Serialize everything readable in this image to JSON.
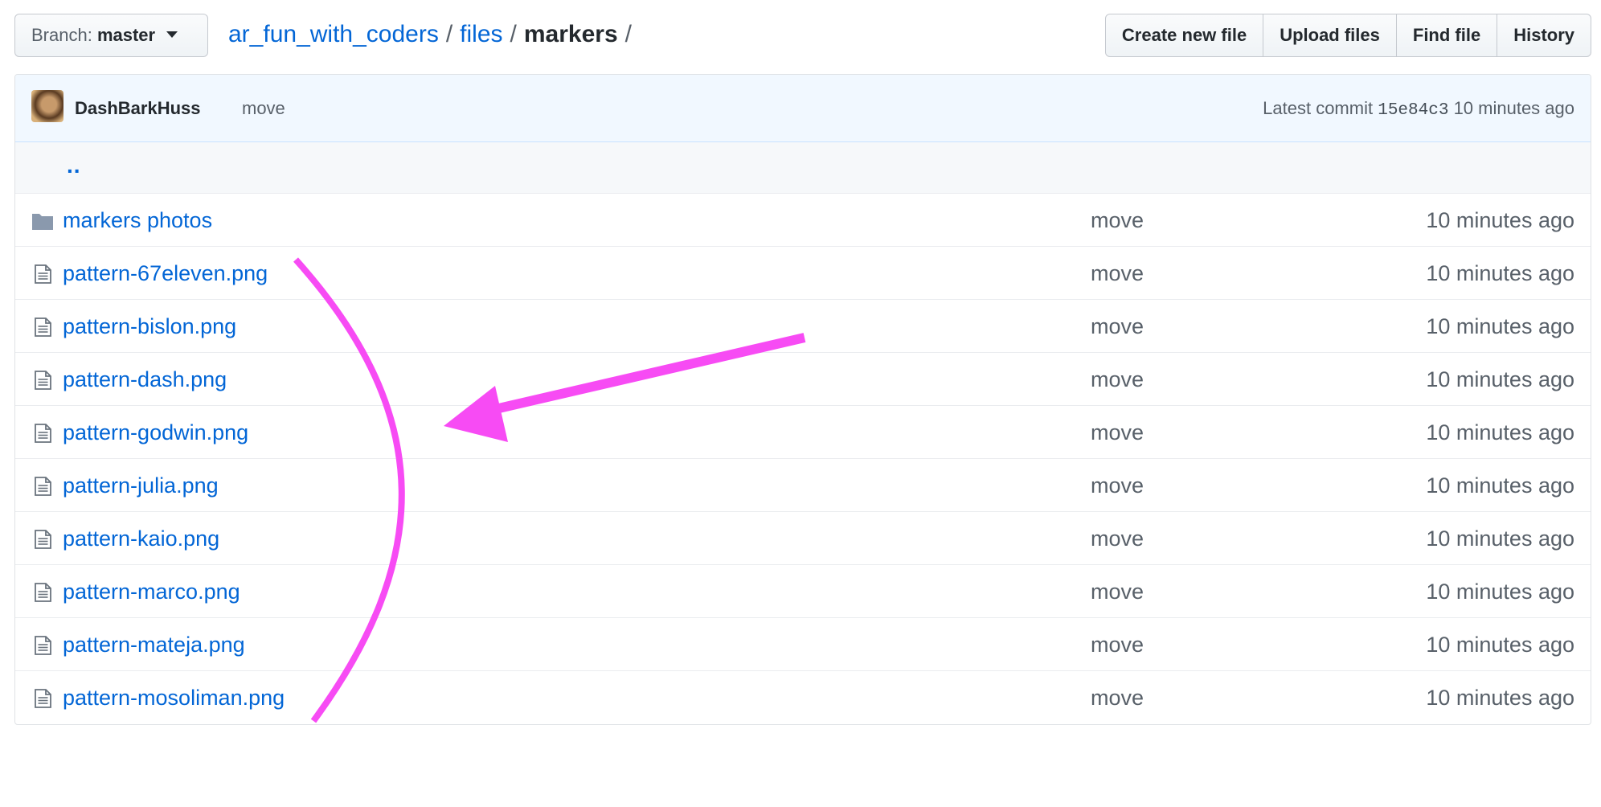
{
  "branch": {
    "label": "Branch:",
    "value": "master"
  },
  "breadcrumb": {
    "repo": "ar_fun_with_coders",
    "sep": "/",
    "folder": "files",
    "current": "markers"
  },
  "actions": [
    "Create new file",
    "Upload files",
    "Find file",
    "History"
  ],
  "commit": {
    "author": "DashBarkHuss",
    "message": "move",
    "latest_label": "Latest commit",
    "sha": "15e84c3",
    "age": "10 minutes ago"
  },
  "parent_link": "..",
  "files": [
    {
      "type": "folder",
      "name": "markers photos",
      "message": "move",
      "age": "10 minutes ago"
    },
    {
      "type": "file",
      "name": "pattern-67eleven.png",
      "message": "move",
      "age": "10 minutes ago"
    },
    {
      "type": "file",
      "name": "pattern-bislon.png",
      "message": "move",
      "age": "10 minutes ago"
    },
    {
      "type": "file",
      "name": "pattern-dash.png",
      "message": "move",
      "age": "10 minutes ago"
    },
    {
      "type": "file",
      "name": "pattern-godwin.png",
      "message": "move",
      "age": "10 minutes ago"
    },
    {
      "type": "file",
      "name": "pattern-julia.png",
      "message": "move",
      "age": "10 minutes ago"
    },
    {
      "type": "file",
      "name": "pattern-kaio.png",
      "message": "move",
      "age": "10 minutes ago"
    },
    {
      "type": "file",
      "name": "pattern-marco.png",
      "message": "move",
      "age": "10 minutes ago"
    },
    {
      "type": "file",
      "name": "pattern-mateja.png",
      "message": "move",
      "age": "10 minutes ago"
    },
    {
      "type": "file",
      "name": "pattern-mosoliman.png",
      "message": "move",
      "age": "10 minutes ago"
    }
  ],
  "annotation": {
    "color": "#f74bf4",
    "shapes": [
      "curved-bracket",
      "arrow"
    ]
  },
  "colors": {
    "link": "#0366d6",
    "commit_bg": "#f1f8ff",
    "muted": "#586069",
    "icon": "#6a737d",
    "folder": "#79b8ff"
  }
}
